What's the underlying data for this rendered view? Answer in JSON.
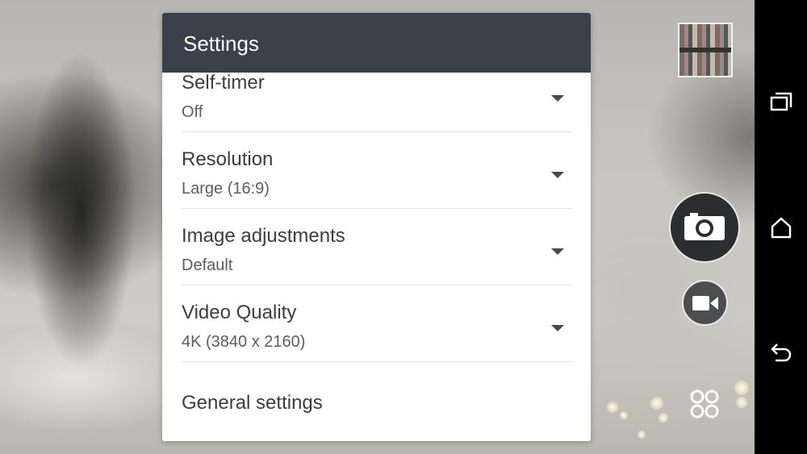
{
  "settings": {
    "title": "Settings",
    "rows": [
      {
        "label": "Self-timer",
        "value": "Off"
      },
      {
        "label": "Resolution",
        "value": "Large (16:9)"
      },
      {
        "label": "Image adjustments",
        "value": "Default"
      },
      {
        "label": "Video Quality",
        "value": "4K (3840 x 2160)"
      }
    ],
    "general_label": "General settings"
  },
  "controls": {
    "thumbnail": "last-photo-thumbnail",
    "photo_shutter_icon": "camera-icon",
    "video_shutter_icon": "video-camera-icon",
    "modes_icon": "camera-modes-icon"
  },
  "navigation": {
    "recents_icon": "recents-icon",
    "home_icon": "home-icon",
    "back_icon": "back-icon"
  },
  "colors": {
    "header": "#3b414b",
    "panel": "#ffffff",
    "shutter": "#2b2d30",
    "navbar": "#000000"
  }
}
